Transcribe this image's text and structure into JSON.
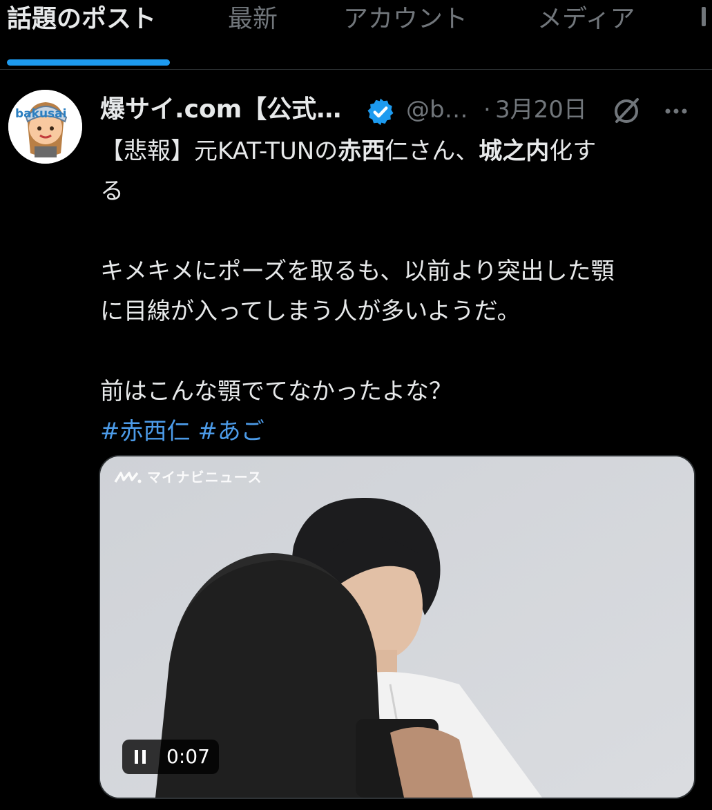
{
  "tabs": {
    "items": [
      "話題のポスト",
      "最新",
      "アカウント",
      "メディア"
    ],
    "active_index": 0
  },
  "post": {
    "display_name": "爆サイ.com【公式…",
    "handle": "@b…",
    "separator": "·",
    "date": "3月20日",
    "avatar_text": "bakusai",
    "text": {
      "l1_a": "【悲報】元KAT-TUNの",
      "l1_b": "赤西",
      "l1_c": "仁さん、",
      "l1_d": "城之内",
      "l1_e": "化す",
      "l2": "る",
      "l3": "キメキメにポーズを取るも、以前より突出した顎",
      "l4": "に目線が入ってしまう人が多いようだ。",
      "l5": "前はこんな顎でてなかったよな？",
      "hashtag1": "#赤西仁",
      "hashtag2": "#あご"
    },
    "media": {
      "watermark": "マイナビニュース",
      "time": "0:07"
    }
  },
  "colors": {
    "accent": "#1d9bf0",
    "hashtag": "#4c9be8",
    "secondary_text": "#71767b",
    "background": "#000000"
  },
  "icons": [
    "verified-badge-icon",
    "grok-icon",
    "more-icon",
    "pause-icon"
  ]
}
